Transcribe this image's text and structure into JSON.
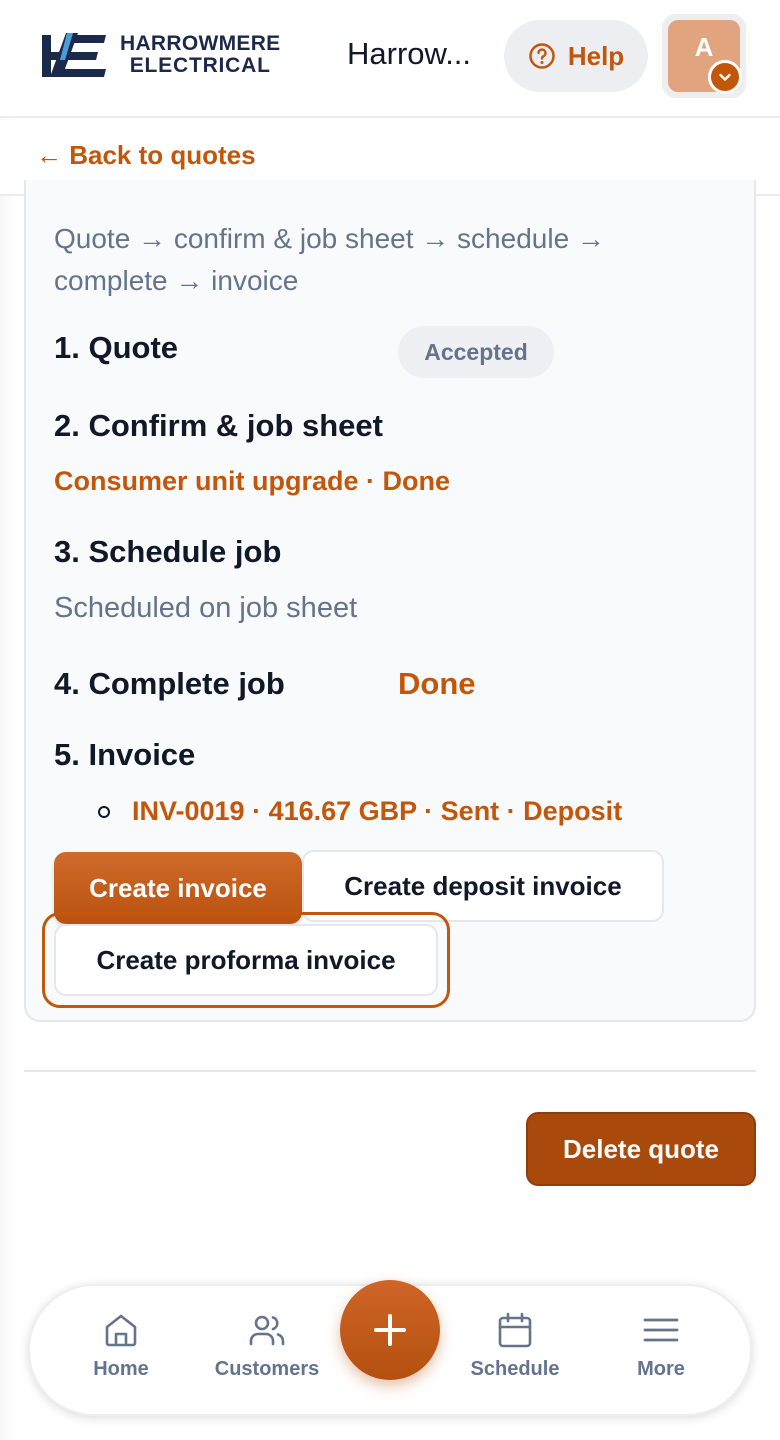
{
  "header": {
    "logo_line1": "HARROWMERE",
    "logo_line2": "ELECTRICAL",
    "company_name": "Harrow...",
    "help_label": "Help",
    "avatar_initial": "A"
  },
  "back_link": "← Back to quotes",
  "workflow": {
    "flow_text": "Quote → confirm & job sheet → schedule → complete → invoice",
    "steps": [
      {
        "title": "1. Quote",
        "badge": "Accepted"
      },
      {
        "title": "2. Confirm & job sheet",
        "detail": "Consumer unit upgrade · Done"
      },
      {
        "title": "3. Schedule job",
        "detail": "Scheduled on job sheet"
      },
      {
        "title": "4. Complete job",
        "status": "Done"
      },
      {
        "title": "5. Invoice",
        "invoices": [
          "INV-0019 · 416.67 GBP · Sent · Deposit"
        ]
      }
    ],
    "buttons": {
      "create_invoice": "Create invoice",
      "create_deposit_invoice": "Create deposit invoice",
      "create_proforma_invoice": "Create proforma invoice"
    }
  },
  "delete_quote": "Delete quote",
  "bottom_nav": {
    "items": [
      {
        "label": "Home",
        "icon": "home-icon"
      },
      {
        "label": "Customers",
        "icon": "users-icon"
      },
      {
        "label": "Schedule",
        "icon": "calendar-icon"
      },
      {
        "label": "More",
        "icon": "menu-icon"
      }
    ],
    "fab_icon": "plus-icon"
  },
  "colors": {
    "accent": "#c2570c",
    "delete": "#a94a0c",
    "muted": "#64748b",
    "logo_navy": "#1b2a4a"
  }
}
